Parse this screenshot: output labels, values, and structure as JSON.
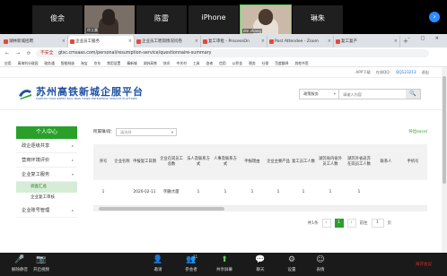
{
  "zoom": {
    "participants": [
      {
        "big": "俊余",
        "small": ""
      },
      {
        "big": "",
        "small": "徐立晨",
        "video": true
      },
      {
        "big": "陈雷",
        "small": ""
      },
      {
        "big": "iPhone",
        "small": ""
      },
      {
        "big": "",
        "small": "dm zhang",
        "video": true
      },
      {
        "big": "琳朱",
        "small": ""
      }
    ],
    "next_arrow": "›",
    "controls": [
      {
        "label": "解除静音",
        "icon": "🎤"
      },
      {
        "label": "开启视频",
        "icon": "📷"
      },
      {
        "label": "邀请",
        "icon": "👤"
      },
      {
        "label": "参会者",
        "icon": "👥",
        "count": "11"
      },
      {
        "label": "共享屏幕",
        "icon": "⬆"
      },
      {
        "label": "聊天",
        "icon": "💬"
      },
      {
        "label": "设置",
        "icon": "⚙"
      },
      {
        "label": "表情",
        "icon": "☺"
      },
      {
        "label": "离开会议",
        "icon": ""
      }
    ]
  },
  "browser": {
    "tabs": [
      {
        "title": "湖林新城招聘",
        "active": false
      },
      {
        "title": "企业员工服务",
        "active": true
      },
      {
        "title": "企业员工稳岗情况问卷",
        "active": false
      },
      {
        "title": "复工审批 - ProcessOn",
        "active": false
      },
      {
        "title": "Post Attendee - Zoom",
        "active": false
      },
      {
        "title": "复工复产",
        "active": false
      }
    ],
    "tab_plus": "+",
    "window_buttons": "– □ ✕",
    "security_warning": "不安全",
    "url": "gtsc.cmsaas.com/personal/resumption-service/questionnaire-summary",
    "bookmarks": [
      "应用",
      "青海利分政园",
      "政务通",
      "智能制造",
      "淘宝",
      "京东",
      "常用设置",
      "精新城",
      "湖苏高铁",
      "快讯",
      "中关村",
      "工具",
      "咨询",
      "信用",
      "公积金",
      "税务",
      "社保",
      "百度翻译",
      "其他书签"
    ]
  },
  "site": {
    "topline": {
      "app_download": "APP下载",
      "qq_label": "在线QQ:",
      "qq": "QQ123213",
      "login": "退出"
    },
    "logo_title": "苏州高铁新城企服平台",
    "logo_subtitle": "SUZHOU HIGH-SPEED RAIL NEW TOWN ENTERPRISE SERVICE PLATFORM",
    "search": {
      "select": "政策服务",
      "placeholder": "请输入内容",
      "button": "🔍"
    },
    "sidebar": {
      "header": "个人中心",
      "items": [
        {
          "label": "政企逐级共享",
          "arrow": "▸"
        },
        {
          "label": "营商环境评价",
          "arrow": "▸"
        },
        {
          "label": "企业复工服务",
          "arrow": "▾"
        }
      ],
      "subitems": [
        {
          "label": "调查汇总",
          "active": true
        },
        {
          "label": "企业复工审核",
          "active": false
        }
      ],
      "last_item": {
        "label": "企业账号管理",
        "arrow": "▸"
      }
    },
    "filter": {
      "label": "所属镇/街:",
      "placeholder": "请选择",
      "export": "导出excel"
    },
    "table": {
      "columns": [
        "序号",
        "企业名称",
        "申报复工日期",
        "企业在岗员工总数",
        "法人及联系方式",
        "人事及联系方式",
        "申报理由",
        "企业主要产品",
        "复工员工人数",
        "湖苏省内省外员工人数",
        "湖苏外省返苏在岗员工人数",
        "联系人",
        "手机号"
      ],
      "rows": [
        [
          "1",
          "",
          "2020-02-11",
          "明融大厦",
          "1",
          "1",
          "1",
          "1",
          "1",
          "1",
          "1",
          "",
          ""
        ]
      ]
    },
    "pager": {
      "total": "共1条",
      "prev": "‹",
      "current": "1",
      "next": "›",
      "goto_label": "前往",
      "goto_value": "1",
      "page_unit": "页"
    }
  }
}
